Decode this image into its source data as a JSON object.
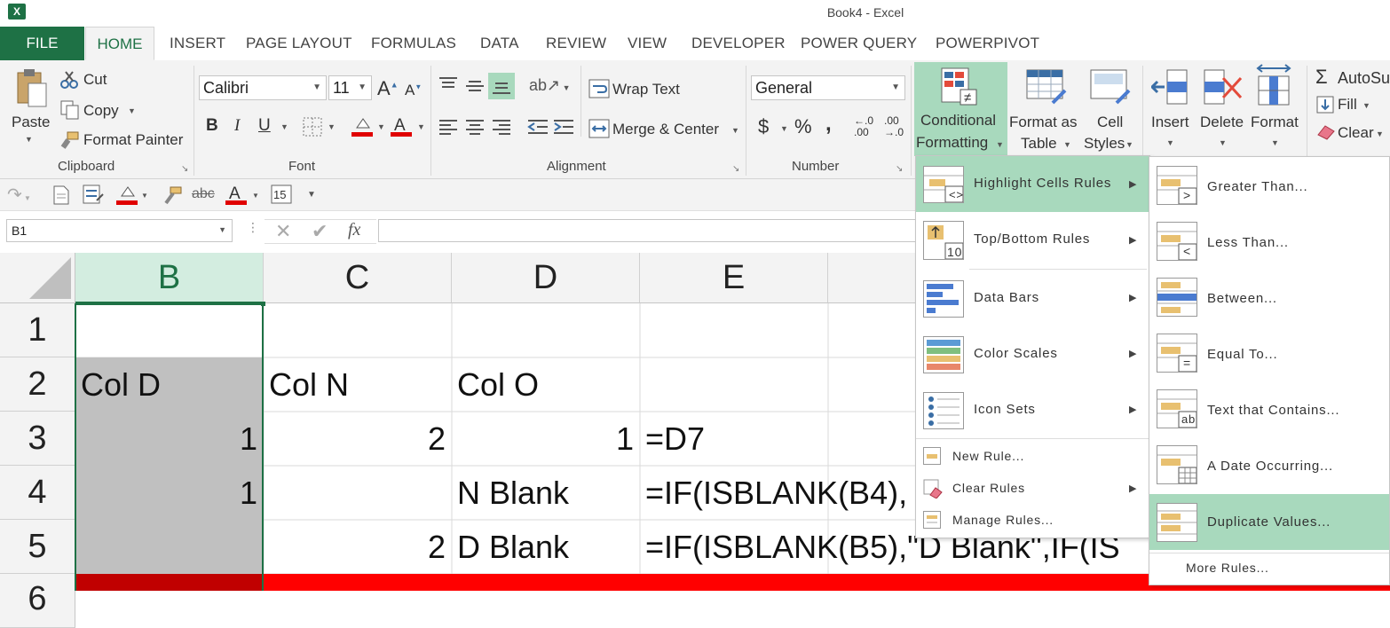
{
  "window": {
    "title": "Book4 - Excel",
    "app_icon": "X"
  },
  "tabs": [
    "FILE",
    "HOME",
    "INSERT",
    "PAGE LAYOUT",
    "FORMULAS",
    "DATA",
    "REVIEW",
    "VIEW",
    "DEVELOPER",
    "POWER QUERY",
    "POWERPIVOT"
  ],
  "ribbon": {
    "clipboard": {
      "paste": "Paste",
      "cut": "Cut",
      "copy": "Copy",
      "format_painter": "Format Painter",
      "label": "Clipboard"
    },
    "font": {
      "name": "Calibri",
      "size": "11",
      "bold": "B",
      "italic": "I",
      "underline": "U",
      "label": "Font"
    },
    "alignment": {
      "wrap_text": "Wrap Text",
      "merge_center": "Merge & Center",
      "label": "Alignment"
    },
    "number": {
      "format": "General",
      "currency": "$",
      "percent": "%",
      "comma": ",",
      "inc_dec": "←.0 .00",
      "dec_dec": ".00 →.0",
      "label": "Number"
    },
    "styles": {
      "cond_fmt_line1": "Conditional",
      "cond_fmt_line2": "Formatting",
      "fmt_table_line1": "Format as",
      "fmt_table_line2": "Table",
      "cell_styles_line1": "Cell",
      "cell_styles_line2": "Styles"
    },
    "cells": {
      "insert": "Insert",
      "delete": "Delete",
      "format": "Format"
    },
    "editing": {
      "autosum": "AutoSu",
      "fill": "Fill",
      "clear": "Clear"
    }
  },
  "formula_bar": {
    "name_box": "B1",
    "fx": "fx",
    "formula": ""
  },
  "grid": {
    "columns": [
      "B",
      "C",
      "D",
      "E"
    ],
    "rows": [
      "1",
      "2",
      "3",
      "4",
      "5",
      "6"
    ],
    "cells": {
      "B2": "Col D",
      "C2": "Col N",
      "D2": "Col O",
      "B3": "1",
      "C3": "2",
      "D3": "1",
      "E3": "=D7",
      "B4": "1",
      "D4": "N Blank",
      "E4": "=IF(ISBLANK(B4),",
      "C5": "2",
      "D5": "D Blank",
      "E5": "=IF(ISBLANK(B5),\"D Blank\",IF(IS"
    }
  },
  "cf_menu": {
    "items": [
      {
        "label": "Highlight Cells Rules",
        "has_submenu": true
      },
      {
        "label": "Top/Bottom Rules",
        "has_submenu": true
      },
      {
        "label": "Data Bars",
        "has_submenu": true
      },
      {
        "label": "Color Scales",
        "has_submenu": true
      },
      {
        "label": "Icon Sets",
        "has_submenu": true
      },
      {
        "label": "New Rule...",
        "has_submenu": false
      },
      {
        "label": "Clear Rules",
        "has_submenu": true
      },
      {
        "label": "Manage Rules...",
        "has_submenu": false
      }
    ],
    "top_bottom_icon_text": "10"
  },
  "submenu": {
    "items": [
      {
        "label": "Greater Than...",
        "icon_text": ">"
      },
      {
        "label": "Less Than...",
        "icon_text": "<"
      },
      {
        "label": "Between...",
        "icon_text": ""
      },
      {
        "label": "Equal To...",
        "icon_text": "="
      },
      {
        "label": "Text that Contains...",
        "icon_text": "ab"
      },
      {
        "label": "A Date Occurring...",
        "icon_text": ""
      },
      {
        "label": "Duplicate Values...",
        "icon_text": ""
      }
    ],
    "more": "More Rules..."
  },
  "colors": {
    "excel_green": "#1e7145",
    "menu_highlight": "#a8d9bd",
    "selected_col_header": "#d3ede0",
    "row6_fill": "#ff0000",
    "row6_selected_fill": "#c00000",
    "selected_range_fill": "#c0c0c0"
  }
}
